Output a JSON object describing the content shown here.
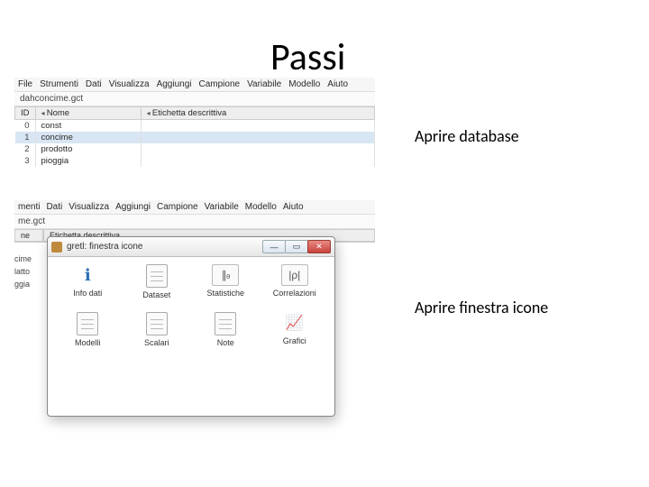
{
  "title": "Passi",
  "caption1": "Aprire database",
  "caption2": "Aprire finestra icone",
  "menubar": [
    "File",
    "Strumenti",
    "Dati",
    "Visualizza",
    "Aggiungi",
    "Campione",
    "Variabile",
    "Modello",
    "Aiuto"
  ],
  "filename": "dahconcime.gct",
  "cols": [
    "ID",
    "Nome",
    "Etichetta descrittiva"
  ],
  "rows": [
    {
      "id": "0",
      "name": "const"
    },
    {
      "id": "1",
      "name": "concime"
    },
    {
      "id": "2",
      "name": "prodotto"
    },
    {
      "id": "3",
      "name": "pioggia"
    }
  ],
  "menubar2": [
    "menti",
    "Dati",
    "Visualizza",
    "Aggiungi",
    "Campione",
    "Variabile",
    "Modello",
    "Aiuto"
  ],
  "filename2": "me.gct",
  "cols2": [
    "ne",
    "Etichetta descrittiva"
  ],
  "siderows": [
    "cime",
    "latto",
    "ggia"
  ],
  "win": {
    "title": "gretl: finestra icone",
    "btn_min": "—",
    "btn_max": "▭",
    "btn_close": "✕",
    "icons": [
      {
        "label": "Info dati",
        "g": "ℹ",
        "cls": "info"
      },
      {
        "label": "Dataset",
        "g": "",
        "cls": "doc"
      },
      {
        "label": "Statistiche",
        "g": "∥₀",
        "cls": "bars"
      },
      {
        "label": "Correlazioni",
        "g": "|ρ|",
        "cls": ""
      },
      {
        "label": "Modelli",
        "g": "",
        "cls": "doc"
      },
      {
        "label": "Scalari",
        "g": "",
        "cls": "doc"
      },
      {
        "label": "Note",
        "g": "",
        "cls": "doc"
      },
      {
        "label": "Grafici",
        "g": "📈",
        "cls": "chart"
      }
    ]
  }
}
